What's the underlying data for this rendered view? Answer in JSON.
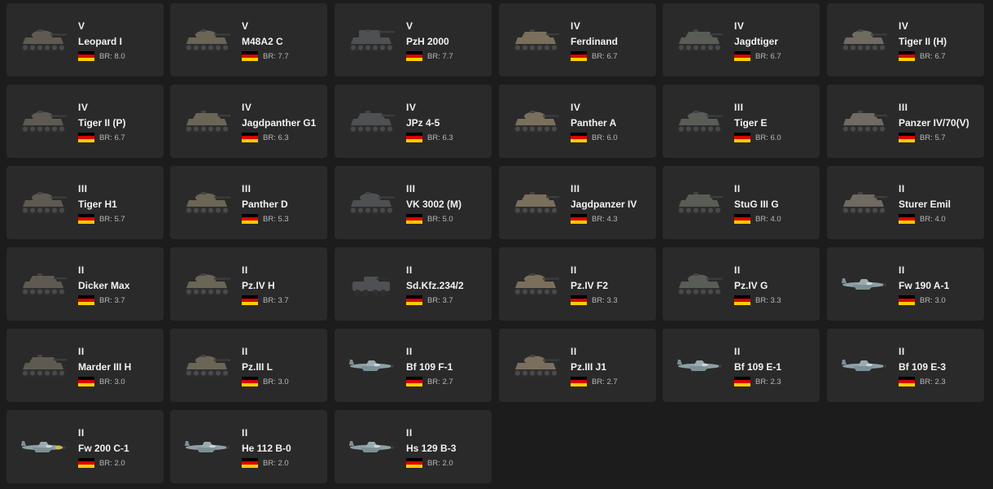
{
  "flag_colors": [
    "#000000",
    "#dd0000",
    "#ffce00"
  ],
  "vehicles": [
    {
      "rank": "V",
      "name": "Leopard I",
      "br": "BR: 8.0",
      "icon": "tank-icon"
    },
    {
      "rank": "V",
      "name": "M48A2 C",
      "br": "BR: 7.7",
      "icon": "tank-icon"
    },
    {
      "rank": "V",
      "name": "PzH 2000",
      "br": "BR: 7.7",
      "icon": "spg-icon"
    },
    {
      "rank": "IV",
      "name": "Ferdinand",
      "br": "BR: 6.7",
      "icon": "tank-destroyer-icon"
    },
    {
      "rank": "IV",
      "name": "Jagdtiger",
      "br": "BR: 6.7",
      "icon": "tank-destroyer-icon"
    },
    {
      "rank": "IV",
      "name": "Tiger II (H)",
      "br": "BR: 6.7",
      "icon": "heavy-tank-icon"
    },
    {
      "rank": "IV",
      "name": "Tiger II (P)",
      "br": "BR: 6.7",
      "icon": "heavy-tank-icon"
    },
    {
      "rank": "IV",
      "name": "Jagdpanther G1",
      "br": "BR: 6.3",
      "icon": "tank-destroyer-icon"
    },
    {
      "rank": "IV",
      "name": "JPz 4-5",
      "br": "BR: 6.3",
      "icon": "tank-destroyer-icon"
    },
    {
      "rank": "IV",
      "name": "Panther A",
      "br": "BR: 6.0",
      "icon": "tank-icon"
    },
    {
      "rank": "III",
      "name": "Tiger E",
      "br": "BR: 6.0",
      "icon": "heavy-tank-icon"
    },
    {
      "rank": "III",
      "name": "Panzer IV/70(V)",
      "br": "BR: 5.7",
      "icon": "tank-destroyer-icon"
    },
    {
      "rank": "III",
      "name": "Tiger H1",
      "br": "BR: 5.7",
      "icon": "heavy-tank-icon"
    },
    {
      "rank": "III",
      "name": "Panther D",
      "br": "BR: 5.3",
      "icon": "tank-icon"
    },
    {
      "rank": "III",
      "name": "VK 3002 (M)",
      "br": "BR: 5.0",
      "icon": "tank-icon"
    },
    {
      "rank": "III",
      "name": "Jagdpanzer IV",
      "br": "BR: 4.3",
      "icon": "tank-destroyer-icon"
    },
    {
      "rank": "II",
      "name": "StuG III G",
      "br": "BR: 4.0",
      "icon": "tank-destroyer-icon"
    },
    {
      "rank": "II",
      "name": "Sturer Emil",
      "br": "BR: 4.0",
      "icon": "tank-destroyer-icon"
    },
    {
      "rank": "II",
      "name": "Dicker Max",
      "br": "BR: 3.7",
      "icon": "tank-destroyer-icon"
    },
    {
      "rank": "II",
      "name": "Pz.IV H",
      "br": "BR: 3.7",
      "icon": "tank-icon"
    },
    {
      "rank": "II",
      "name": "Sd.Kfz.234/2",
      "br": "BR: 3.7",
      "icon": "armored-car-icon"
    },
    {
      "rank": "II",
      "name": "Pz.IV F2",
      "br": "BR: 3.3",
      "icon": "tank-icon"
    },
    {
      "rank": "II",
      "name": "Pz.IV G",
      "br": "BR: 3.3",
      "icon": "tank-icon"
    },
    {
      "rank": "II",
      "name": "Fw 190 A-1",
      "br": "BR: 3.0",
      "icon": "plane-icon"
    },
    {
      "rank": "II",
      "name": "Marder III H",
      "br": "BR: 3.0",
      "icon": "tank-destroyer-icon"
    },
    {
      "rank": "II",
      "name": "Pz.III L",
      "br": "BR: 3.0",
      "icon": "tank-icon"
    },
    {
      "rank": "II",
      "name": "Bf 109 F-1",
      "br": "BR: 2.7",
      "icon": "plane-icon"
    },
    {
      "rank": "II",
      "name": "Pz.III J1",
      "br": "BR: 2.7",
      "icon": "tank-icon"
    },
    {
      "rank": "II",
      "name": "Bf 109 E-1",
      "br": "BR: 2.3",
      "icon": "plane-icon"
    },
    {
      "rank": "II",
      "name": "Bf 109 E-3",
      "br": "BR: 2.3",
      "icon": "plane-icon"
    },
    {
      "rank": "II",
      "name": "Fw 200 C-1",
      "br": "BR: 2.0",
      "icon": "plane-icon"
    },
    {
      "rank": "II",
      "name": "He 112 B-0",
      "br": "BR: 2.0",
      "icon": "plane-icon"
    },
    {
      "rank": "II",
      "name": "Hs 129 B-3",
      "br": "BR: 2.0",
      "icon": "plane-icon"
    }
  ]
}
